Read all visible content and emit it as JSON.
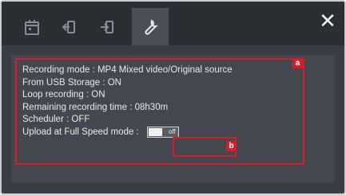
{
  "window": {
    "tabs": [
      {
        "icon": "calendar-icon",
        "active": false
      },
      {
        "icon": "usb-export-icon",
        "active": false
      },
      {
        "icon": "usb-import-icon",
        "active": false
      },
      {
        "icon": "wrench-icon",
        "active": true
      }
    ],
    "close_label": "✕"
  },
  "info": {
    "recording_mode": "Recording mode : MP4 Mixed video/Original source",
    "from_usb": "From USB Storage : ON",
    "loop_recording": "Loop recording : ON",
    "remaining_time": "Remaining recording time : 08h30m",
    "scheduler": "Scheduler : OFF",
    "upload_label": "Upload at Full Speed mode :"
  },
  "toggle": {
    "state_label": "off"
  },
  "callouts": {
    "a": "a",
    "b": "b"
  },
  "colors": {
    "callout": "#d21f2d",
    "panel": "#3a3e44",
    "tabbar": "#2b2e33"
  }
}
